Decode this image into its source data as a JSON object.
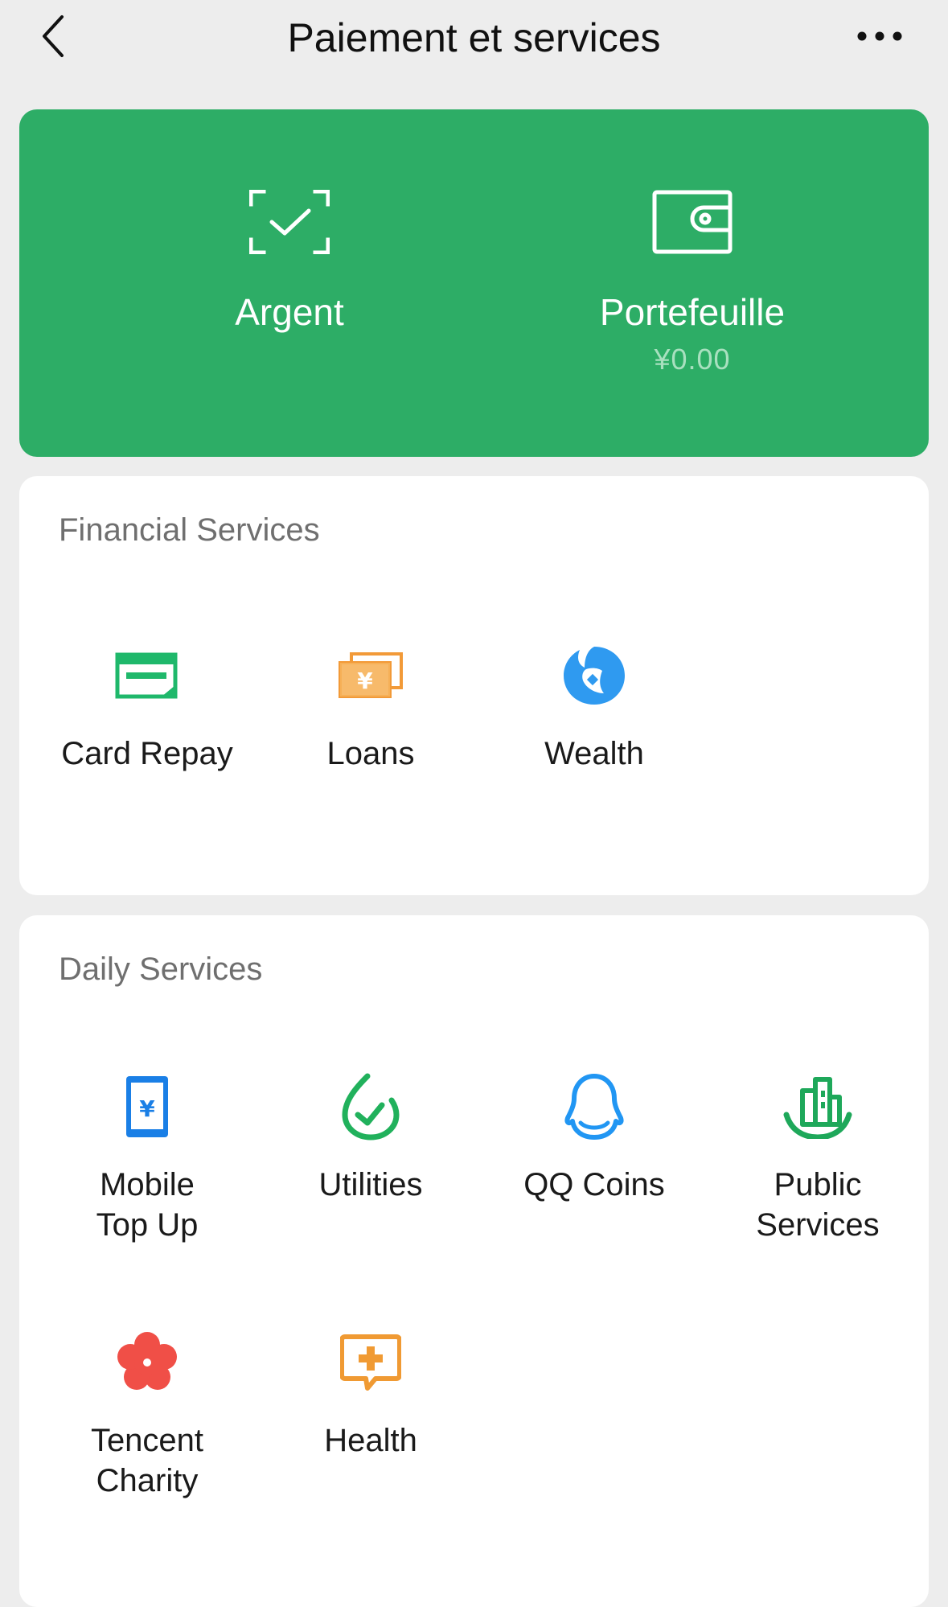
{
  "header": {
    "title": "Paiement et services"
  },
  "hero": {
    "money": {
      "label": "Argent"
    },
    "wallet": {
      "label": "Portefeuille",
      "balance": "¥0.00"
    }
  },
  "financial": {
    "title": "Financial Services",
    "items": [
      {
        "label": "Card Repay",
        "icon": "card-repay-icon"
      },
      {
        "label": "Loans",
        "icon": "loans-icon"
      },
      {
        "label": "Wealth",
        "icon": "wealth-icon"
      }
    ]
  },
  "daily": {
    "title": "Daily Services",
    "items": [
      {
        "label": "Mobile\nTop Up",
        "icon": "mobile-top-up-icon"
      },
      {
        "label": "Utilities",
        "icon": "utilities-icon"
      },
      {
        "label": "QQ Coins",
        "icon": "qq-coins-icon"
      },
      {
        "label": "Public\nServices",
        "icon": "public-services-icon"
      },
      {
        "label": "Tencent\nCharity",
        "icon": "tencent-charity-icon"
      },
      {
        "label": "Health",
        "icon": "health-icon"
      }
    ]
  },
  "colors": {
    "brand_green": "#2dad66",
    "background": "#ededed",
    "card_repay": "#1fb86b",
    "loans": "#f29a38",
    "wealth": "#2f9af0",
    "mobile": "#1a7fe6",
    "utilities": "#21b15c",
    "qq": "#2196f3",
    "public": "#1ea85a",
    "charity": "#f04f47",
    "health": "#f09a33"
  }
}
